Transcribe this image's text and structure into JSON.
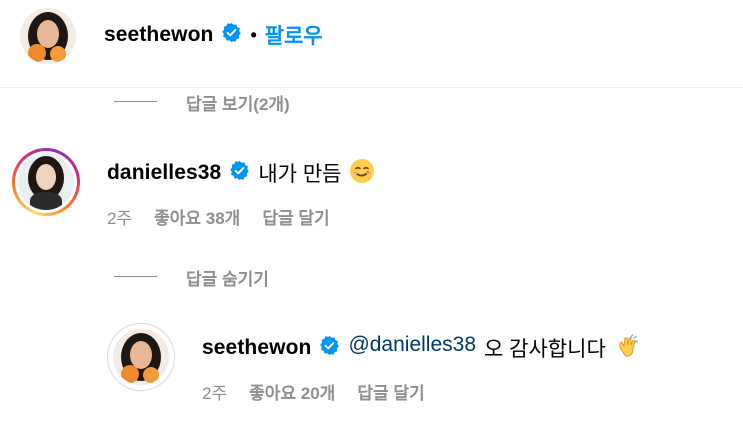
{
  "header": {
    "username": "seethewon",
    "follow_label": "팔로우",
    "separator": "•"
  },
  "view_replies_top": "답글 보기(2개)",
  "comment": {
    "username": "danielles38",
    "text": "내가 만듬",
    "time": "2주",
    "likes": "좋아요 38개",
    "reply_label": "답글 달기",
    "emoji_icon": "smirk-face-icon"
  },
  "hide_replies": "답글 숨기기",
  "reply": {
    "username": "seethewon",
    "mention": "@danielles38",
    "text": "오 감사합니다",
    "time": "2주",
    "likes": "좋아요 20개",
    "reply_label": "답글 달기",
    "emoji_icon": "clapping-hands-icon"
  },
  "colors": {
    "link_blue": "#0095f6",
    "mention_blue": "#00376b",
    "muted_gray": "#8e8e8e",
    "verified_blue": "#0095f6"
  }
}
